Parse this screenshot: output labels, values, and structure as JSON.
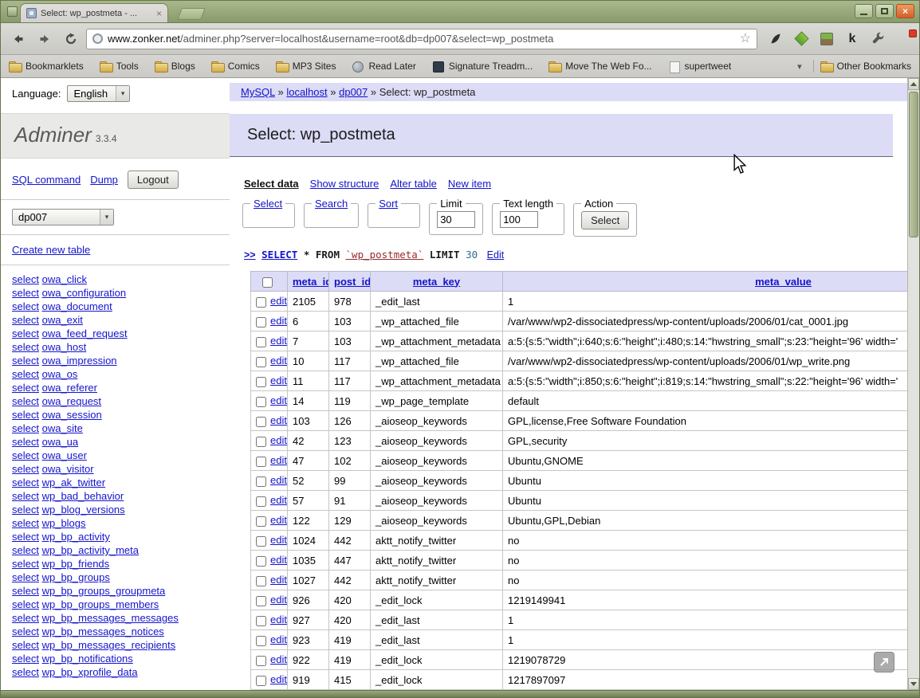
{
  "window": {
    "tab_title": "Select: wp_postmeta - ...",
    "controls": {
      "minimize": "minimize",
      "maximize": "maximize",
      "close": "×"
    }
  },
  "browser": {
    "url_domain": "www.zonker.net",
    "url_path": "/adminer.php?server=localhost&username=root&db=dp007&select=wp_postmeta",
    "star_glyph": "☆",
    "extensions": {
      "k_glyph": "k"
    },
    "bookmarks": [
      {
        "label": "Bookmarklets",
        "icon": "folder"
      },
      {
        "label": "Tools",
        "icon": "folder"
      },
      {
        "label": "Blogs",
        "icon": "folder"
      },
      {
        "label": "Comics",
        "icon": "folder"
      },
      {
        "label": "MP3 Sites",
        "icon": "folder"
      },
      {
        "label": "Read Later",
        "icon": "site"
      },
      {
        "label": "Signature Treadm...",
        "icon": "dark"
      },
      {
        "label": "Move The Web Fo...",
        "icon": "folder"
      },
      {
        "label": "supertweet",
        "icon": "page"
      }
    ],
    "overflow_chevron": "▾",
    "other_bookmarks_label": "Other Bookmarks"
  },
  "sidebar": {
    "language_label": "Language:",
    "language_value": "English",
    "app_name": "Adminer",
    "app_version": "3.3.4",
    "sql_command_label": "SQL command",
    "dump_label": "Dump",
    "logout_label": "Logout",
    "database_value": "dp007",
    "create_table_label": "Create new table",
    "select_prefix": "select",
    "tables": [
      "owa_click",
      "owa_configuration",
      "owa_document",
      "owa_exit",
      "owa_feed_request",
      "owa_host",
      "owa_impression",
      "owa_os",
      "owa_referer",
      "owa_request",
      "owa_session",
      "owa_site",
      "owa_ua",
      "owa_user",
      "owa_visitor",
      "wp_ak_twitter",
      "wp_bad_behavior",
      "wp_blog_versions",
      "wp_blogs",
      "wp_bp_activity",
      "wp_bp_activity_meta",
      "wp_bp_friends",
      "wp_bp_groups",
      "wp_bp_groups_groupmeta",
      "wp_bp_groups_members",
      "wp_bp_messages_messages",
      "wp_bp_messages_notices",
      "wp_bp_messages_recipients",
      "wp_bp_notifications",
      "wp_bp_xprofile_data"
    ]
  },
  "main": {
    "breadcrumb": {
      "links": [
        "MySQL",
        "localhost",
        "dp007"
      ],
      "separator": "»",
      "current": "Select: wp_postmeta"
    },
    "title": "Select: wp_postmeta",
    "menu": [
      "Select data",
      "Show structure",
      "Alter table",
      "New item"
    ],
    "filters": {
      "select_legend": "Select",
      "search_legend": "Search",
      "sort_legend": "Sort",
      "limit_legend": "Limit",
      "limit_value": "30",
      "textlen_legend": "Text length",
      "textlen_value": "100",
      "action_legend": "Action",
      "action_button": "Select"
    },
    "query": {
      "prompt": ">>",
      "select_kw": "SELECT",
      "middle": "* FROM",
      "table_ref": "`wp_postmeta`",
      "limit_kw": "LIMIT",
      "limit_val": "30",
      "edit_label": "Edit"
    },
    "table": {
      "edit_label": "edit",
      "headers": [
        "meta_id",
        "post_id",
        "meta_key",
        "meta_value"
      ],
      "rows": [
        [
          "2105",
          "978",
          "_edit_last",
          "1"
        ],
        [
          "6",
          "103",
          "_wp_attached_file",
          "/var/www/wp2-dissociatedpress/wp-content/uploads/2006/01/cat_0001.jpg"
        ],
        [
          "7",
          "103",
          "_wp_attachment_metadata",
          "a:5:{s:5:\"width\";i:640;s:6:\"height\";i:480;s:14:\"hwstring_small\";s:23:\"height='96' width='"
        ],
        [
          "10",
          "117",
          "_wp_attached_file",
          "/var/www/wp2-dissociatedpress/wp-content/uploads/2006/01/wp_write.png"
        ],
        [
          "11",
          "117",
          "_wp_attachment_metadata",
          "a:5:{s:5:\"width\";i:850;s:6:\"height\";i:819;s:14:\"hwstring_small\";s:22:\"height='96' width='"
        ],
        [
          "14",
          "119",
          "_wp_page_template",
          "default"
        ],
        [
          "103",
          "126",
          "_aioseop_keywords",
          "GPL,license,Free Software Foundation"
        ],
        [
          "42",
          "123",
          "_aioseop_keywords",
          "GPL,security"
        ],
        [
          "47",
          "102",
          "_aioseop_keywords",
          "Ubuntu,GNOME"
        ],
        [
          "52",
          "99",
          "_aioseop_keywords",
          "Ubuntu"
        ],
        [
          "57",
          "91",
          "_aioseop_keywords",
          "Ubuntu"
        ],
        [
          "122",
          "129",
          "_aioseop_keywords",
          "Ubuntu,GPL,Debian"
        ],
        [
          "1024",
          "442",
          "aktt_notify_twitter",
          "no"
        ],
        [
          "1035",
          "447",
          "aktt_notify_twitter",
          "no"
        ],
        [
          "1027",
          "442",
          "aktt_notify_twitter",
          "no"
        ],
        [
          "926",
          "420",
          "_edit_lock",
          "1219149941"
        ],
        [
          "927",
          "420",
          "_edit_last",
          "1"
        ],
        [
          "923",
          "419",
          "_edit_last",
          "1"
        ],
        [
          "922",
          "419",
          "_edit_lock",
          "1219078729"
        ],
        [
          "919",
          "415",
          "_edit_lock",
          "1217897097"
        ]
      ]
    }
  },
  "colors": {
    "accent_lavender": "#dcdcf6",
    "link_blue": "#1414cc",
    "titlebar_olive": "#8a9a6c",
    "table_name_red": "#992b2b"
  }
}
